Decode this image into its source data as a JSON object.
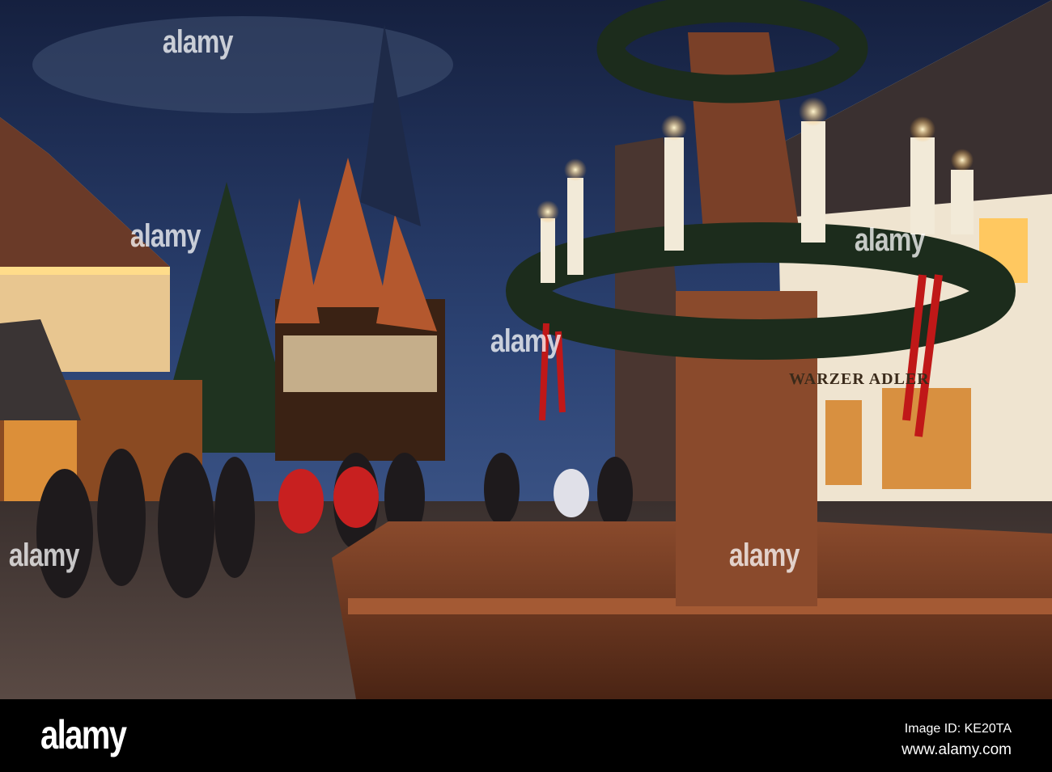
{
  "photo": {
    "sign_text": "WARZER ADLER"
  },
  "watermark": {
    "text": "alamy"
  },
  "footer": {
    "logo": "alamy",
    "image_id": "Image ID: KE20TA",
    "url": "www.alamy.com"
  }
}
